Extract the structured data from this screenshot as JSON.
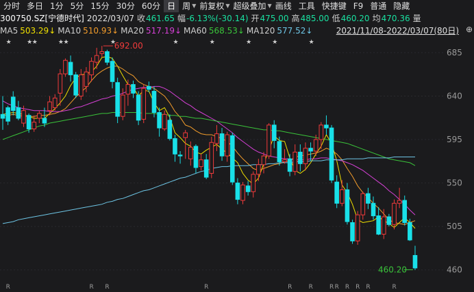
{
  "toolbar": {
    "items": [
      "分时",
      "多日",
      "1分",
      "5分",
      "15分",
      "30分",
      "60分",
      "日",
      "周",
      "前复权",
      "超级叠加",
      "画线",
      "工具",
      "快捷键",
      "F9",
      "普通",
      "隐藏"
    ],
    "active": "日"
  },
  "quote": {
    "code_name": "300750.SZ[宁德时代]",
    "date": "2022/03/07",
    "close_label": "收",
    "close": "461.65",
    "change_label": "幅",
    "change": "-6.13%(-30.14)",
    "open_label": "开",
    "open": "475.00",
    "high_label": "高",
    "high": "485.00",
    "low_label": "低",
    "low": "460.20",
    "avg_label": "均",
    "avg": "470.36",
    "vol_label": "量"
  },
  "ma": {
    "ma5_label": "MA5",
    "ma5": "503.29↓",
    "ma10_label": "MA10",
    "ma10": "510.93↓",
    "ma20_label": "MA20",
    "ma20": "517.19↓",
    "ma60_label": "MA60",
    "ma60": "568.53↓",
    "ma120_label": "MA120",
    "ma120": "577.52↓",
    "range": "2021/11/08-2022/03/07(80日)"
  },
  "colors": {
    "up": "#f23b3b",
    "down": "#19e0e8",
    "ma5": "#f0e000",
    "ma10": "#f29c2b",
    "ma20": "#d640d6",
    "ma60": "#3ac43a",
    "ma120": "#6ec6e6"
  },
  "chart_data": {
    "type": "candlestick",
    "y_ticks": [
      "685",
      "640",
      "595",
      "550",
      "505",
      "460"
    ],
    "ylim": [
      452,
      697
    ],
    "annotations": {
      "high": "692.00",
      "low": "460.20"
    },
    "candles": [
      [
        621,
        617,
        640,
        605
      ],
      [
        628,
        614,
        630,
        610
      ],
      [
        639,
        625,
        645,
        620
      ],
      [
        628,
        617,
        635,
        615
      ],
      [
        612,
        625,
        630,
        608
      ],
      [
        620,
        606,
        622,
        602
      ],
      [
        606,
        613,
        620,
        603
      ],
      [
        617,
        622,
        625,
        612
      ],
      [
        617,
        612,
        628,
        608
      ],
      [
        625,
        634,
        640,
        620
      ],
      [
        628,
        638,
        642,
        625
      ],
      [
        643,
        663,
        668,
        630
      ],
      [
        663,
        677,
        679,
        660
      ],
      [
        675,
        662,
        682,
        655
      ],
      [
        662,
        641,
        665,
        638
      ],
      [
        640,
        662,
        668,
        636
      ],
      [
        650,
        665,
        670,
        644
      ],
      [
        662,
        676,
        680,
        655
      ],
      [
        675,
        682,
        690,
        668
      ],
      [
        684,
        686,
        692,
        680
      ],
      [
        686,
        675,
        688,
        672
      ],
      [
        676,
        655,
        680,
        648
      ],
      [
        654,
        619,
        659,
        612
      ],
      [
        619,
        641,
        648,
        615
      ],
      [
        642,
        652,
        657,
        630
      ],
      [
        652,
        643,
        656,
        638
      ],
      [
        641,
        615,
        645,
        610
      ],
      [
        616,
        648,
        652,
        612
      ],
      [
        650,
        647,
        655,
        644
      ],
      [
        645,
        623,
        650,
        618
      ],
      [
        623,
        607,
        628,
        598
      ],
      [
        606,
        621,
        625,
        604
      ],
      [
        615,
        596,
        621,
        594
      ],
      [
        596,
        580,
        600,
        572
      ],
      [
        579,
        578,
        583,
        570
      ],
      [
        597,
        602,
        605,
        575
      ],
      [
        575,
        587,
        593,
        568
      ],
      [
        588,
        566,
        590,
        560
      ],
      [
        567,
        574,
        580,
        563
      ],
      [
        574,
        556,
        580,
        554
      ],
      [
        560,
        592,
        598,
        555
      ],
      [
        591,
        601,
        610,
        583
      ],
      [
        601,
        578,
        607,
        573
      ],
      [
        578,
        600,
        603,
        572
      ],
      [
        599,
        551,
        602,
        548
      ],
      [
        550,
        533,
        555,
        528
      ],
      [
        532,
        548,
        551,
        528
      ],
      [
        547,
        541,
        552,
        537
      ],
      [
        541,
        559,
        562,
        535
      ],
      [
        559,
        569,
        575,
        552
      ],
      [
        569,
        578,
        582,
        560
      ],
      [
        578,
        610,
        612,
        575
      ],
      [
        610,
        594,
        615,
        586
      ],
      [
        593,
        572,
        598,
        568
      ],
      [
        572,
        574,
        585,
        570
      ],
      [
        575,
        562,
        580,
        557
      ],
      [
        562,
        582,
        590,
        558
      ],
      [
        582,
        570,
        590,
        562
      ],
      [
        570,
        586,
        592,
        563
      ],
      [
        586,
        583,
        592,
        573
      ],
      [
        583,
        595,
        600,
        578
      ],
      [
        595,
        610,
        613,
        585
      ],
      [
        610,
        607,
        620,
        600
      ],
      [
        607,
        553,
        610,
        550
      ],
      [
        551,
        529,
        558,
        524
      ],
      [
        529,
        543,
        553,
        526
      ],
      [
        543,
        510,
        550,
        507
      ],
      [
        509,
        490,
        512,
        487
      ],
      [
        490,
        517,
        521,
        486
      ],
      [
        517,
        539,
        541,
        512
      ],
      [
        539,
        529,
        545,
        523
      ],
      [
        529,
        516,
        536,
        512
      ],
      [
        516,
        497,
        525,
        496
      ],
      [
        497,
        515,
        523,
        492
      ],
      [
        515,
        507,
        518,
        505
      ],
      [
        507,
        529,
        533,
        502
      ],
      [
        529,
        532,
        545,
        524
      ],
      [
        532,
        509,
        537,
        506
      ],
      [
        509,
        491,
        513,
        490
      ],
      [
        475,
        462,
        485,
        460
      ]
    ],
    "series": [
      {
        "name": "MA5",
        "values": [
          621,
          622,
          623,
          622,
          621,
          619,
          617,
          617,
          617,
          622,
          627,
          633,
          640,
          651,
          659,
          662,
          663,
          665,
          671,
          680,
          681,
          679,
          671,
          661,
          652,
          649,
          640,
          646,
          645,
          633,
          625,
          628,
          618,
          602,
          597,
          591,
          588,
          582,
          580,
          584,
          587,
          590,
          585,
          581,
          576,
          571,
          560,
          553,
          549,
          555,
          570,
          584,
          599,
          594,
          593,
          576,
          563,
          560,
          564,
          571,
          580,
          588,
          600,
          591,
          573,
          548,
          540,
          528,
          512,
          509,
          510,
          511,
          515,
          511,
          508,
          504,
          509,
          514,
          509,
          503
        ]
      },
      {
        "name": "MA10",
        "values": [
          620,
          620,
          621,
          620,
          619,
          619,
          619,
          620,
          620,
          621,
          622,
          624,
          627,
          633,
          639,
          644,
          649,
          656,
          662,
          666,
          669,
          671,
          671,
          668,
          664,
          661,
          655,
          652,
          650,
          648,
          644,
          640,
          633,
          624,
          618,
          610,
          608,
          604,
          601,
          600,
          600,
          598,
          596,
          593,
          588,
          581,
          575,
          570,
          565,
          563,
          565,
          567,
          569,
          570,
          572,
          573,
          577,
          578,
          579,
          580,
          581,
          583,
          586,
          584,
          580,
          574,
          565,
          557,
          547,
          540,
          535,
          529,
          524,
          518,
          512,
          509,
          508,
          507,
          509,
          511
        ]
      },
      {
        "name": "MA20",
        "values": [
          635,
          632,
          630,
          628,
          627,
          626,
          625,
          625,
          625,
          624,
          624,
          624,
          625,
          626,
          628,
          629,
          631,
          633,
          635,
          637,
          638,
          640,
          641,
          643,
          645,
          647,
          648,
          649,
          649,
          650,
          650,
          648,
          645,
          641,
          637,
          633,
          630,
          626,
          623,
          620,
          617,
          614,
          610,
          606,
          602,
          597,
          593,
          589,
          585,
          582,
          580,
          578,
          577,
          576,
          575,
          575,
          574,
          574,
          574,
          575,
          575,
          576,
          576,
          575,
          574,
          573,
          571,
          569,
          566,
          563,
          559,
          555,
          551,
          547,
          542,
          538,
          533,
          528,
          522,
          517
        ]
      },
      {
        "name": "MA60",
        "values": [
          595,
          597,
          599,
          601,
          603,
          605,
          607,
          609,
          610,
          612,
          613,
          614,
          615,
          616,
          617,
          618,
          619,
          620,
          621,
          622,
          622,
          623,
          623,
          623,
          623,
          623,
          623,
          622,
          622,
          622,
          621,
          621,
          620,
          620,
          619,
          619,
          618,
          617,
          617,
          616,
          615,
          614,
          613,
          612,
          611,
          610,
          609,
          608,
          607,
          606,
          605,
          605,
          604,
          604,
          603,
          602,
          601,
          600,
          599,
          598,
          597,
          596,
          595,
          594,
          593,
          592,
          591,
          589,
          587,
          585,
          583,
          581,
          579,
          577,
          575,
          574,
          573,
          572,
          571,
          568
        ]
      },
      {
        "name": "MA120",
        "values": [
          508,
          509,
          510,
          512,
          513,
          514,
          515,
          516,
          517,
          518,
          519,
          520,
          521,
          522,
          523,
          524,
          525,
          526,
          527,
          528,
          530,
          531,
          533,
          534,
          536,
          538,
          540,
          542,
          543,
          545,
          547,
          549,
          551,
          553,
          555,
          556,
          558,
          560,
          562,
          563,
          565,
          566,
          567,
          567,
          568,
          568,
          568,
          568,
          569,
          569,
          569,
          570,
          570,
          571,
          571,
          571,
          572,
          572,
          572,
          573,
          573,
          573,
          574,
          574,
          574,
          574,
          575,
          575,
          575,
          575,
          576,
          576,
          576,
          576,
          576,
          577,
          577,
          577,
          577,
          577
        ]
      }
    ],
    "star_markers_text": "★",
    "r_marker_text": "R"
  }
}
